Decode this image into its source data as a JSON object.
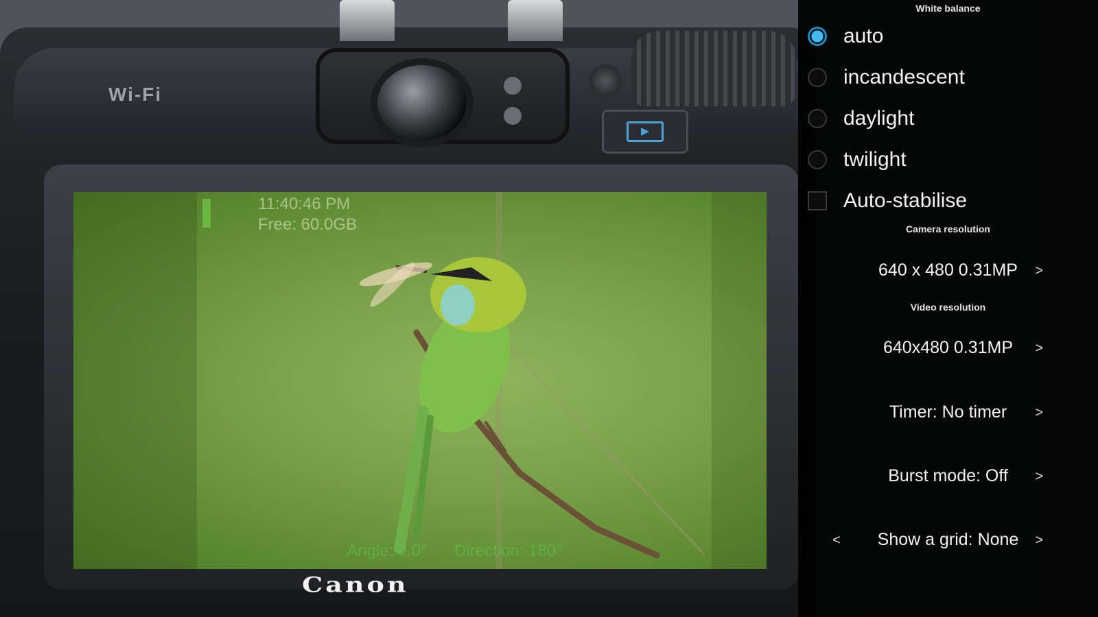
{
  "camera": {
    "wifi_label": "Wi-Fi",
    "brand": "Canon"
  },
  "preview": {
    "time": "11:40:46 PM",
    "free_space": "Free: 60.0GB",
    "angle": "Angle: 0.0°",
    "direction": "Direction: 180°"
  },
  "settings": {
    "white_balance_header": "White balance",
    "white_balance_options": [
      {
        "label": "auto",
        "selected": true
      },
      {
        "label": "incandescent",
        "selected": false
      },
      {
        "label": "daylight",
        "selected": false
      },
      {
        "label": "twilight",
        "selected": false
      }
    ],
    "auto_stabilise": {
      "label": "Auto-stabilise",
      "checked": false
    },
    "camera_resolution_header": "Camera resolution",
    "camera_resolution": "640 x 480 0.31MP",
    "video_resolution_header": "Video resolution",
    "video_resolution": "640x480 0.31MP",
    "timer": "Timer: No timer",
    "burst_mode": "Burst mode: Off",
    "grid": "Show a grid: None",
    "next_arrow": ">",
    "prev_arrow": "<"
  },
  "colors": {
    "accent": "#43b9f0",
    "panel_bg": "#000000",
    "preview_green": "#79a04a"
  },
  "icons": {
    "playback": "playback-icon",
    "selected_radio": "radio-checked-icon"
  }
}
